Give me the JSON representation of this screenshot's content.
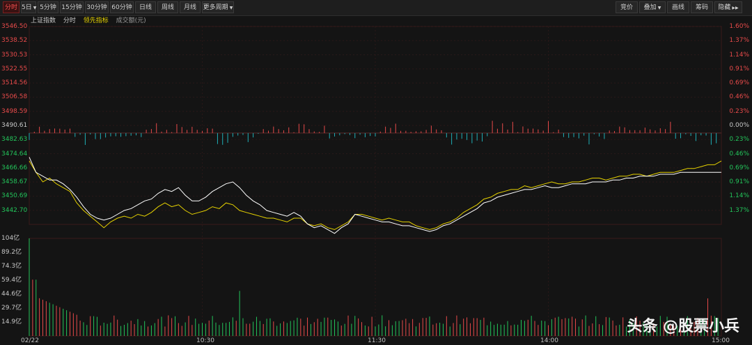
{
  "toolbar": {
    "left_buttons": [
      "分时",
      "5日",
      "5分钟",
      "15分钟",
      "30分钟",
      "60分钟",
      "日线",
      "周线",
      "月线",
      "更多周期"
    ],
    "right_buttons": [
      "竞价",
      "叠加",
      "画线",
      "筹码",
      "隐藏"
    ]
  },
  "legend": {
    "index_name": "上证指数",
    "mode": "分时",
    "lead_indicator": "领先指标",
    "volume_label": "成交额(元)"
  },
  "colors": {
    "up": "#e84a4a",
    "down": "#23c45a",
    "index_line": "#ffffff",
    "lead_line": "#e6d200",
    "macd_down": "#1fb0b8"
  },
  "chart_data": {
    "type": "line",
    "y_price_ticks": [
      "3546.50",
      "3538.52",
      "3530.53",
      "3522.55",
      "3514.56",
      "3506.58",
      "3498.59",
      "3490.61",
      "3482.63",
      "3474.64",
      "3466.66",
      "3458.67",
      "3450.69",
      "3442.70"
    ],
    "y_pct_ticks": [
      "1.60%",
      "1.37%",
      "1.14%",
      "0.91%",
      "0.69%",
      "0.46%",
      "0.23%",
      "0.00%",
      "0.23%",
      "0.46%",
      "0.69%",
      "0.91%",
      "1.14%",
      "1.37%"
    ],
    "prev_close": 3490.61,
    "ylim": [
      3442.7,
      3546.5
    ],
    "x_ticks": [
      "02/22",
      "10:30",
      "11:30",
      "14:00",
      "15:00"
    ],
    "volume_ticks": [
      "104亿",
      "89.2亿",
      "74.3亿",
      "59.4亿",
      "44.6亿",
      "29.7亿",
      "14.9亿"
    ],
    "volume_ylim": [
      0,
      104
    ],
    "series": [
      {
        "points": [
          [
            0,
            3476
          ],
          [
            4,
            3470
          ],
          [
            8,
            3465
          ],
          [
            12,
            3467
          ],
          [
            16,
            3464
          ],
          [
            20,
            3462
          ],
          [
            24,
            3460
          ],
          [
            28,
            3454
          ],
          [
            32,
            3450
          ],
          [
            36,
            3447
          ],
          [
            40,
            3444
          ],
          [
            44,
            3441
          ],
          [
            48,
            3444
          ],
          [
            52,
            3446
          ],
          [
            56,
            3447
          ],
          [
            60,
            3446
          ],
          [
            64,
            3448
          ],
          [
            68,
            3447
          ],
          [
            72,
            3449
          ],
          [
            76,
            3452
          ],
          [
            80,
            3454
          ],
          [
            84,
            3452
          ],
          [
            88,
            3453
          ],
          [
            92,
            3450
          ],
          [
            96,
            3448
          ],
          [
            100,
            3449
          ],
          [
            104,
            3450
          ],
          [
            108,
            3452
          ],
          [
            112,
            3451
          ],
          [
            116,
            3454
          ],
          [
            120,
            3453
          ],
          [
            124,
            3450
          ],
          [
            128,
            3449
          ],
          [
            132,
            3448
          ],
          [
            136,
            3447
          ],
          [
            140,
            3446
          ],
          [
            144,
            3446
          ],
          [
            148,
            3445
          ],
          [
            152,
            3444
          ],
          [
            156,
            3446
          ],
          [
            160,
            3446
          ],
          [
            164,
            3443
          ],
          [
            168,
            3442
          ],
          [
            172,
            3443
          ],
          [
            176,
            3441
          ],
          [
            180,
            3440
          ],
          [
            184,
            3442
          ],
          [
            188,
            3444
          ],
          [
            192,
            3448
          ],
          [
            196,
            3448
          ],
          [
            200,
            3447
          ],
          [
            204,
            3446
          ],
          [
            208,
            3445
          ],
          [
            212,
            3446
          ],
          [
            216,
            3445
          ],
          [
            220,
            3444
          ],
          [
            224,
            3444
          ],
          [
            228,
            3442
          ],
          [
            232,
            3441
          ],
          [
            236,
            3440
          ],
          [
            240,
            3441
          ],
          [
            244,
            3443
          ],
          [
            248,
            3444
          ],
          [
            252,
            3446
          ],
          [
            256,
            3449
          ],
          [
            260,
            3451
          ],
          [
            264,
            3453
          ],
          [
            268,
            3456
          ],
          [
            272,
            3457
          ],
          [
            276,
            3459
          ],
          [
            280,
            3460
          ],
          [
            284,
            3461
          ],
          [
            288,
            3461
          ],
          [
            292,
            3463
          ],
          [
            296,
            3462
          ],
          [
            300,
            3463
          ],
          [
            304,
            3464
          ],
          [
            308,
            3465
          ],
          [
            312,
            3464
          ],
          [
            316,
            3464
          ],
          [
            320,
            3465
          ],
          [
            324,
            3465
          ],
          [
            328,
            3466
          ],
          [
            332,
            3467
          ],
          [
            336,
            3467
          ],
          [
            340,
            3466
          ],
          [
            344,
            3467
          ],
          [
            348,
            3468
          ],
          [
            352,
            3468
          ],
          [
            356,
            3469
          ],
          [
            360,
            3469
          ],
          [
            364,
            3468
          ],
          [
            368,
            3469
          ],
          [
            372,
            3470
          ],
          [
            376,
            3470
          ],
          [
            380,
            3470
          ],
          [
            384,
            3471
          ],
          [
            388,
            3472
          ],
          [
            392,
            3472
          ],
          [
            396,
            3473
          ],
          [
            400,
            3474
          ],
          [
            404,
            3474
          ],
          [
            408,
            3476
          ]
        ]
      },
      {
        "points": [
          [
            0,
            3478
          ],
          [
            4,
            3470
          ],
          [
            8,
            3468
          ],
          [
            12,
            3466
          ],
          [
            16,
            3466
          ],
          [
            20,
            3464
          ],
          [
            24,
            3461
          ],
          [
            28,
            3457
          ],
          [
            32,
            3452
          ],
          [
            36,
            3448
          ],
          [
            40,
            3446
          ],
          [
            44,
            3445
          ],
          [
            48,
            3446
          ],
          [
            52,
            3448
          ],
          [
            56,
            3450
          ],
          [
            60,
            3451
          ],
          [
            64,
            3453
          ],
          [
            68,
            3455
          ],
          [
            72,
            3456
          ],
          [
            76,
            3459
          ],
          [
            80,
            3461
          ],
          [
            84,
            3460
          ],
          [
            88,
            3462
          ],
          [
            92,
            3458
          ],
          [
            96,
            3455
          ],
          [
            100,
            3455
          ],
          [
            104,
            3457
          ],
          [
            108,
            3460
          ],
          [
            112,
            3462
          ],
          [
            116,
            3464
          ],
          [
            120,
            3465
          ],
          [
            124,
            3462
          ],
          [
            128,
            3458
          ],
          [
            132,
            3455
          ],
          [
            136,
            3453
          ],
          [
            140,
            3450
          ],
          [
            144,
            3449
          ],
          [
            148,
            3448
          ],
          [
            152,
            3447
          ],
          [
            156,
            3449
          ],
          [
            160,
            3447
          ],
          [
            164,
            3443
          ],
          [
            168,
            3441
          ],
          [
            172,
            3442
          ],
          [
            176,
            3440
          ],
          [
            180,
            3438
          ],
          [
            184,
            3441
          ],
          [
            188,
            3443
          ],
          [
            192,
            3448
          ],
          [
            196,
            3447
          ],
          [
            200,
            3446
          ],
          [
            204,
            3445
          ],
          [
            208,
            3444
          ],
          [
            212,
            3444
          ],
          [
            216,
            3443
          ],
          [
            220,
            3442
          ],
          [
            224,
            3442
          ],
          [
            228,
            3441
          ],
          [
            232,
            3440
          ],
          [
            236,
            3439
          ],
          [
            240,
            3440
          ],
          [
            244,
            3442
          ],
          [
            248,
            3443
          ],
          [
            252,
            3445
          ],
          [
            256,
            3447
          ],
          [
            260,
            3449
          ],
          [
            264,
            3451
          ],
          [
            268,
            3454
          ],
          [
            272,
            3455
          ],
          [
            276,
            3457
          ],
          [
            280,
            3458
          ],
          [
            284,
            3459
          ],
          [
            288,
            3460
          ],
          [
            292,
            3461
          ],
          [
            296,
            3461
          ],
          [
            300,
            3462
          ],
          [
            304,
            3463
          ],
          [
            308,
            3462
          ],
          [
            312,
            3462
          ],
          [
            316,
            3463
          ],
          [
            320,
            3464
          ],
          [
            324,
            3464
          ],
          [
            328,
            3464
          ],
          [
            332,
            3465
          ],
          [
            336,
            3465
          ],
          [
            340,
            3465
          ],
          [
            344,
            3466
          ],
          [
            348,
            3466
          ],
          [
            352,
            3467
          ],
          [
            356,
            3467
          ],
          [
            360,
            3468
          ],
          [
            364,
            3468
          ],
          [
            368,
            3468
          ],
          [
            372,
            3469
          ],
          [
            376,
            3469
          ],
          [
            380,
            3469
          ],
          [
            384,
            3470
          ],
          [
            388,
            3470
          ],
          [
            392,
            3470
          ],
          [
            396,
            3470
          ],
          [
            400,
            3470
          ],
          [
            404,
            3470
          ],
          [
            408,
            3470
          ]
        ]
      }
    ]
  },
  "watermark": "头条 @股票小兵"
}
